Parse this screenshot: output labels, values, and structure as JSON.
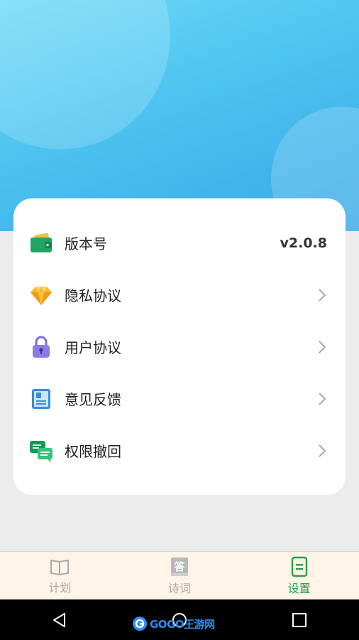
{
  "settings": {
    "items": [
      {
        "label": "版本号",
        "value": "v2.0.8",
        "icon": "wallet-icon",
        "has_chevron": false
      },
      {
        "label": "隐私协议",
        "icon": "diamond-icon",
        "has_chevron": true
      },
      {
        "label": "用户协议",
        "icon": "lock-icon",
        "has_chevron": true
      },
      {
        "label": "意见反馈",
        "icon": "notebook-icon",
        "has_chevron": true
      },
      {
        "label": "权限撤回",
        "icon": "chat-bubbles-icon",
        "has_chevron": true
      }
    ]
  },
  "tabbar": {
    "tabs": [
      {
        "label": "计划",
        "icon": "book-open-icon",
        "active": false
      },
      {
        "label": "诗词",
        "icon": "answer-book-icon",
        "active": false,
        "icon_text": "答"
      },
      {
        "label": "设置",
        "icon": "document-icon",
        "active": true
      }
    ],
    "active_color": "#2e9d4a",
    "inactive_color": "#a9a9a9"
  },
  "watermark": {
    "text": "GOGO王游网"
  },
  "colors": {
    "hero_gradient_start": "#6fd9f7",
    "hero_gradient_end": "#3aa7e6",
    "background": "#ececec",
    "card": "#ffffff"
  }
}
